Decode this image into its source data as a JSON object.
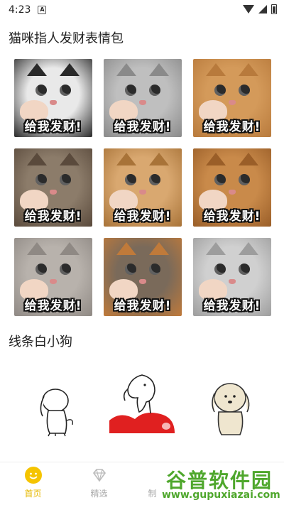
{
  "status_bar": {
    "time": "4:23",
    "notification_badge": "A"
  },
  "sections": [
    {
      "title": "猫咪指人发财表情包",
      "stickers": [
        {
          "caption": "给我发财!",
          "fur": "#e9e9e9",
          "accent": "#2a2a2a"
        },
        {
          "caption": "给我发财!",
          "fur": "#bfbfbf",
          "accent": "#8a8a8a"
        },
        {
          "caption": "给我发财!",
          "fur": "#d49a5a",
          "accent": "#b87a3c"
        },
        {
          "caption": "给我发财!",
          "fur": "#8c7c6a",
          "accent": "#5a4a3c"
        },
        {
          "caption": "给我发财!",
          "fur": "#d9a870",
          "accent": "#a87338"
        },
        {
          "caption": "给我发财!",
          "fur": "#c98a4a",
          "accent": "#9a5e28"
        },
        {
          "caption": "给我发财!",
          "fur": "#b8b2ac",
          "accent": "#8f8984"
        },
        {
          "caption": "给我发财!",
          "fur": "#7a6a5a",
          "accent": "#c07a3a"
        },
        {
          "caption": "给我发财!",
          "fur": "#d0d0d0",
          "accent": "#9d9d9d"
        }
      ]
    },
    {
      "title": "线条白小狗"
    }
  ],
  "tabbar": {
    "tabs": [
      {
        "label": "首页",
        "icon": "smile-icon",
        "active": true
      },
      {
        "label": "精选",
        "icon": "diamond-icon",
        "active": false
      },
      {
        "label": "制作表情",
        "icon": "lightbulb-icon",
        "active": false
      },
      {
        "label": "",
        "icon": "user-icon",
        "active": false
      }
    ]
  },
  "watermark": {
    "title": "谷普软件园",
    "url": "www.gupuxiazai.com"
  },
  "colors": {
    "accent": "#f5c400",
    "watermark_green": "#4fa72d"
  }
}
